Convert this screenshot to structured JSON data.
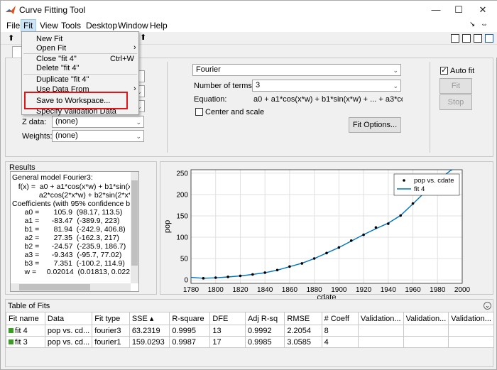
{
  "window": {
    "title": "Curve Fitting Tool",
    "minimize": "—",
    "maximize": "☐",
    "close": "✕"
  },
  "menubar": [
    "File",
    "Fit",
    "View",
    "Tools",
    "Desktop",
    "Window",
    "Help"
  ],
  "fit_menu": {
    "items": [
      {
        "label": "New Fit",
        "shortcut": ""
      },
      {
        "label": "Open Fit",
        "shortcut": "›"
      },
      {
        "label": "Close \"fit 4\"",
        "shortcut": "Ctrl+W"
      },
      {
        "label": "Delete \"fit 4\"",
        "shortcut": ""
      },
      {
        "label": "Duplicate \"fit 4\"",
        "shortcut": ""
      },
      {
        "label": "Use Data From",
        "shortcut": "›"
      },
      {
        "label": "Save to Workspace...",
        "shortcut": ""
      },
      {
        "label": "Specify Validation Data",
        "shortcut": ""
      }
    ]
  },
  "fit_panel": {
    "zdata_label": "Z data:",
    "zdata_value": "(none)",
    "weights_label": "Weights:",
    "weights_value": "(none)",
    "fit_type": "Fourier",
    "terms_label": "Number of terms:",
    "terms_value": "3",
    "equation_label": "Equation:",
    "equation_value": "a0 + a1*cos(x*w) + b1*sin(x*w) + ... + a3*cos(3...",
    "center_scale_label": "Center and scale",
    "fit_options": "Fit Options...",
    "auto_fit_label": "Auto fit",
    "fit_button": "Fit",
    "stop_button": "Stop"
  },
  "results": {
    "title": "Results",
    "lines": [
      "General model Fourier3:",
      "   f(x) =  a0 + a1*cos(x*w) + b1*sin(x*w",
      "             a2*cos(2*x*w) + b2*sin(2*x*w",
      "Coefficients (with 95% confidence bou",
      "      a0 =       105.9  (98.17, 113.5)",
      "      a1 =      -83.47  (-389.9, 223)",
      "      b1 =       81.94  (-242.9, 406.8)",
      "      a2 =       27.35  (-162.3, 217)",
      "      b2 =      -24.57  (-235.9, 186.7)",
      "      a3 =      -9.343  (-95.7, 77.02)",
      "      b3 =       7.351  (-100.2, 114.9)",
      "      w =     0.02014  (0.01813, 0.02216)"
    ]
  },
  "chart_data": {
    "type": "scatter",
    "xlabel": "cdate",
    "ylabel": "pop",
    "xlim": [
      1780,
      2000
    ],
    "ylim": [
      -8,
      258
    ],
    "xticks": [
      1780,
      1800,
      1820,
      1840,
      1860,
      1880,
      1900,
      1920,
      1940,
      1960,
      1980,
      2000
    ],
    "yticks": [
      0,
      50,
      100,
      150,
      200,
      250
    ],
    "legend_position": "top-right",
    "series": [
      {
        "name": "pop vs. cdate",
        "kind": "points",
        "color": "#000000",
        "x": [
          1790,
          1800,
          1810,
          1820,
          1830,
          1840,
          1850,
          1860,
          1870,
          1880,
          1890,
          1900,
          1910,
          1920,
          1930,
          1940,
          1950,
          1960,
          1970
        ],
        "y": [
          3.9,
          5.3,
          7.2,
          9.6,
          12.9,
          17.1,
          23.1,
          31.4,
          38.6,
          50.2,
          62.9,
          76.0,
          92.0,
          105.7,
          122.8,
          131.7,
          150.7,
          179.0,
          205.0
        ]
      },
      {
        "name": "fit 4",
        "kind": "line",
        "color": "#0072bd",
        "x": [
          1780,
          1790,
          1800,
          1810,
          1820,
          1830,
          1840,
          1850,
          1860,
          1870,
          1880,
          1890,
          1900,
          1910,
          1920,
          1930,
          1940,
          1950,
          1960,
          1970,
          1980,
          1990,
          2000
        ],
        "y": [
          6,
          4,
          5,
          7,
          9.5,
          13,
          17,
          23,
          31,
          39,
          50,
          63,
          76,
          91,
          106,
          120,
          133,
          151,
          178,
          206,
          232,
          255,
          270
        ]
      }
    ]
  },
  "table": {
    "title": "Table of Fits",
    "headers": [
      "Fit name",
      "Data",
      "Fit type",
      "SSE ▴",
      "R-square",
      "DFE",
      "Adj R-sq",
      "RMSE",
      "# Coeff",
      "Validation...",
      "Validation...",
      "Validation..."
    ],
    "rows": [
      {
        "color": "#3a9d23",
        "cells": [
          "fit 4",
          "pop vs. cd...",
          "fourier3",
          "63.2319",
          "0.9995",
          "13",
          "0.9992",
          "2.2054",
          "8",
          "",
          "",
          ""
        ]
      },
      {
        "color": "#3a9d23",
        "cells": [
          "fit 3",
          "pop vs. cd...",
          "fourier1",
          "159.0293",
          "0.9987",
          "17",
          "0.9985",
          "3.0585",
          "4",
          "",
          "",
          ""
        ]
      }
    ]
  }
}
